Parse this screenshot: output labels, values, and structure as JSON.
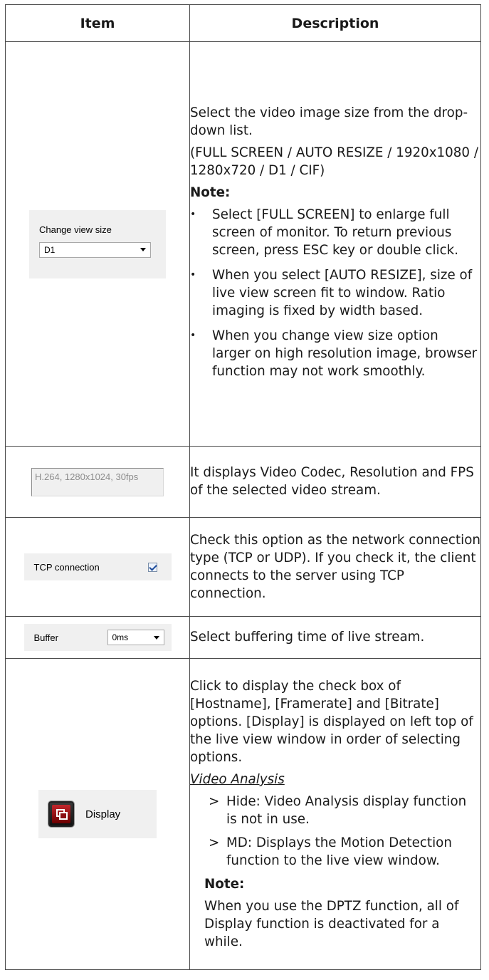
{
  "header": {
    "item": "Item",
    "description": "Description"
  },
  "rows": {
    "view_size": {
      "widget": {
        "label": "Change view size",
        "selected": "D1"
      },
      "p1": "Select the video image size from the drop-down list.",
      "p2": "(FULL SCREEN / AUTO RESIZE / 1920x1080 / 1280x720 / D1 / CIF)",
      "note_label": "Note:",
      "bullets": [
        "Select [FULL SCREEN] to enlarge full screen of monitor. To return previous screen, press ESC key or double click.",
        "When you select [AUTO RESIZE], size of live view screen fit to window. Ratio imaging is fixed by width based.",
        "When you change view size option larger on high resolution image, browser function may not work smoothly."
      ]
    },
    "codec": {
      "widget": {
        "value": "H.264, 1280x1024, 30fps"
      },
      "text": "It displays Video Codec, Resolution and FPS of the selected video stream."
    },
    "tcp": {
      "widget": {
        "label": "TCP connection",
        "checked": true
      },
      "text": "Check this option as the network connection type (TCP or UDP). If you check it, the client connects to the server using TCP connection."
    },
    "buffer": {
      "widget": {
        "label": "Buffer",
        "selected": "0ms"
      },
      "text": "Select buffering time of live stream."
    },
    "display": {
      "widget": {
        "label": "Display",
        "icon": "display-icon"
      },
      "p1": "Click to display the check box of [Hostname], [Framerate] and [Bitrate] options. [Display] is displayed on left top of the live view window in order of selecting options.",
      "subheading": "Video Analysis",
      "items": [
        "Hide: Video Analysis display function is not in use.",
        "MD: Displays the Motion Detection function to the live view window."
      ],
      "note_label": "Note:",
      "note": "When you use the DPTZ function, all of Display function is deactivated for a while."
    }
  }
}
